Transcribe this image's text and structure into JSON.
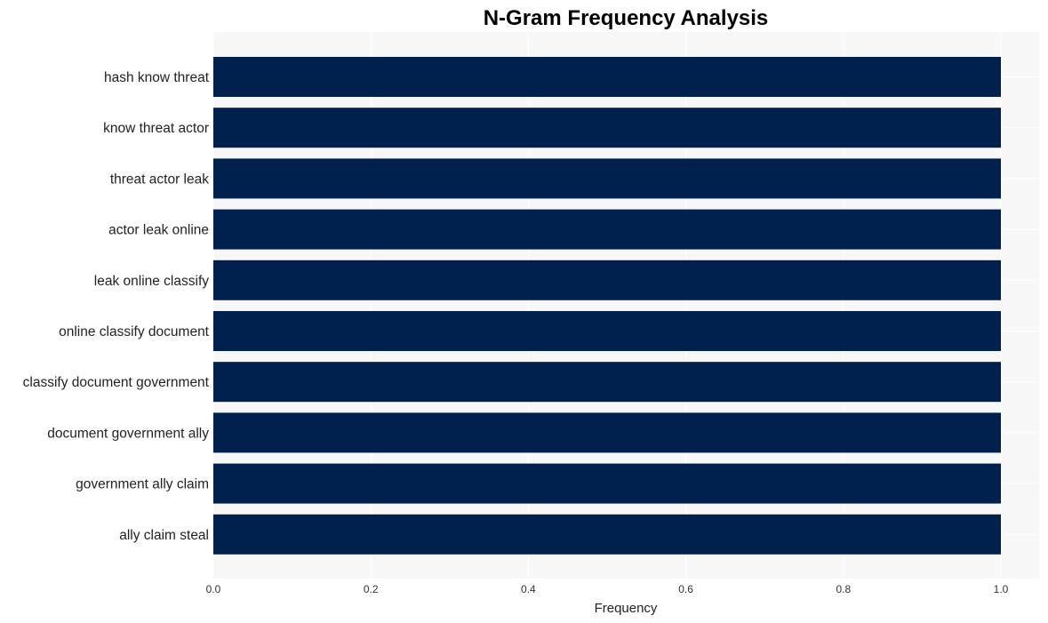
{
  "chart_data": {
    "type": "bar",
    "orientation": "horizontal",
    "title": "N-Gram Frequency Analysis",
    "xlabel": "Frequency",
    "ylabel": "",
    "xlim": [
      0,
      1.05
    ],
    "xticks": [
      0.0,
      0.2,
      0.4,
      0.6,
      0.8,
      1.0
    ],
    "xtick_labels": [
      "0.0",
      "0.2",
      "0.4",
      "0.6",
      "0.8",
      "1.0"
    ],
    "grid": true,
    "categories": [
      "hash know threat",
      "know threat actor",
      "threat actor leak",
      "actor leak online",
      "leak online classify",
      "online classify document",
      "classify document government",
      "document government ally",
      "government ally claim",
      "ally claim steal"
    ],
    "values": [
      1,
      1,
      1,
      1,
      1,
      1,
      1,
      1,
      1,
      1
    ],
    "colors": {
      "bar": "#00214d",
      "plot_background": "#f7f7f7",
      "grid": "#ffffff"
    }
  }
}
